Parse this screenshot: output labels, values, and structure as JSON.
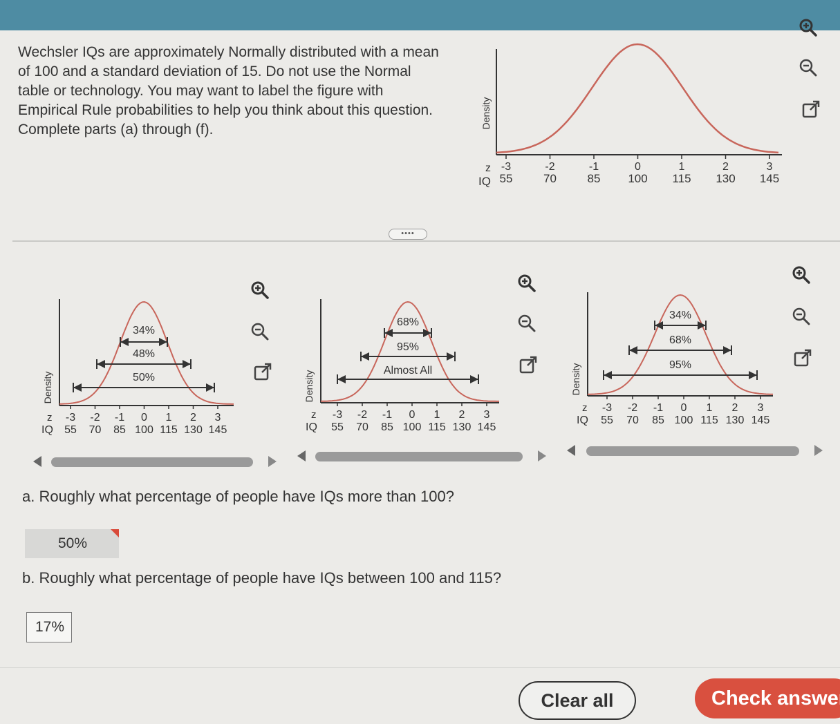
{
  "intro": {
    "lines": [
      "Wechsler IQs are approximately Normally distributed with a mean",
      "of 100 and a standard deviation of 15. Do not use the Normal",
      "table or technology. You may want to label the figure with",
      "Empirical Rule probabilities to help you think about this question.",
      "Complete parts (a) through (f)."
    ]
  },
  "main_figure": {
    "ylabel": "Density",
    "z_label": "z",
    "iq_label": "IQ",
    "z_ticks": [
      "-3",
      "-2",
      "-1",
      "0",
      "1",
      "2",
      "3"
    ],
    "iq_ticks": [
      "55",
      "70",
      "85",
      "100",
      "115",
      "130",
      "145"
    ]
  },
  "more_button": "••••",
  "options": [
    {
      "ylabel": "Density",
      "z_label": "z",
      "iq_label": "IQ",
      "z_ticks": [
        "-3",
        "-2",
        "-1",
        "0",
        "1",
        "2",
        "3"
      ],
      "iq_ticks": [
        "55",
        "70",
        "85",
        "100",
        "115",
        "130",
        "145"
      ],
      "labels": [
        "34%",
        "48%",
        "50%"
      ]
    },
    {
      "ylabel": "Density",
      "z_label": "z",
      "iq_label": "IQ",
      "z_ticks": [
        "-3",
        "-2",
        "-1",
        "0",
        "1",
        "2",
        "3"
      ],
      "iq_ticks": [
        "55",
        "70",
        "85",
        "100",
        "115",
        "130",
        "145"
      ],
      "labels": [
        "68%",
        "95%",
        "Almost All"
      ]
    },
    {
      "ylabel": "Density",
      "z_label": "z",
      "iq_label": "IQ",
      "z_ticks": [
        "-3",
        "-2",
        "-1",
        "0",
        "1",
        "2",
        "3"
      ],
      "iq_ticks": [
        "55",
        "70",
        "85",
        "100",
        "115",
        "130",
        "145"
      ],
      "labels": [
        "34%",
        "68%",
        "95%"
      ]
    }
  ],
  "tools": {
    "zoom_in": "zoom-in-icon",
    "zoom_out": "zoom-out-icon",
    "open_new": "external-link-icon"
  },
  "questions": {
    "a": {
      "text": "a. Roughly what percentage of people have IQs more than 100?",
      "answer": "50%"
    },
    "b": {
      "text": "b. Roughly what percentage of people have IQs between 100 and 115?",
      "answer": "17%"
    }
  },
  "buttons": {
    "clear": "Clear all",
    "check": "Check answer"
  },
  "colors": {
    "curve": "#c8665b",
    "accent": "#d9503f",
    "topbar": "#4e8ca3"
  }
}
